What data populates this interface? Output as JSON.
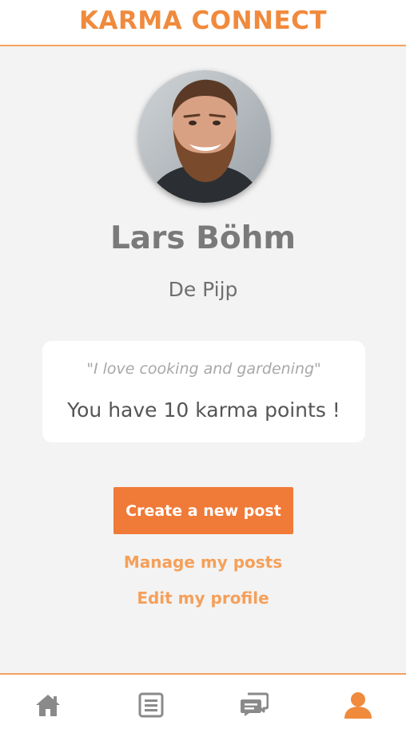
{
  "header": {
    "title": "KARMA CONNECT"
  },
  "profile": {
    "name": "Lars Böhm",
    "location": "De Pijp",
    "bio": "\"I love cooking and gardening\"",
    "karma_text": "You have 10 karma points !"
  },
  "actions": {
    "create_post_label": "Create a new post",
    "manage_posts_label": "Manage my posts",
    "edit_profile_label": "Edit my profile"
  },
  "nav": {
    "items": [
      {
        "icon": "home-icon",
        "active": false
      },
      {
        "icon": "list-icon",
        "active": false
      },
      {
        "icon": "chat-icon",
        "active": false
      },
      {
        "icon": "user-icon",
        "active": true
      }
    ]
  },
  "colors": {
    "accent": "#f08a3c",
    "link": "#f5a05a",
    "button": "#f07a37",
    "nav_inactive": "#8a8a8a",
    "background": "#f3f3f3"
  }
}
